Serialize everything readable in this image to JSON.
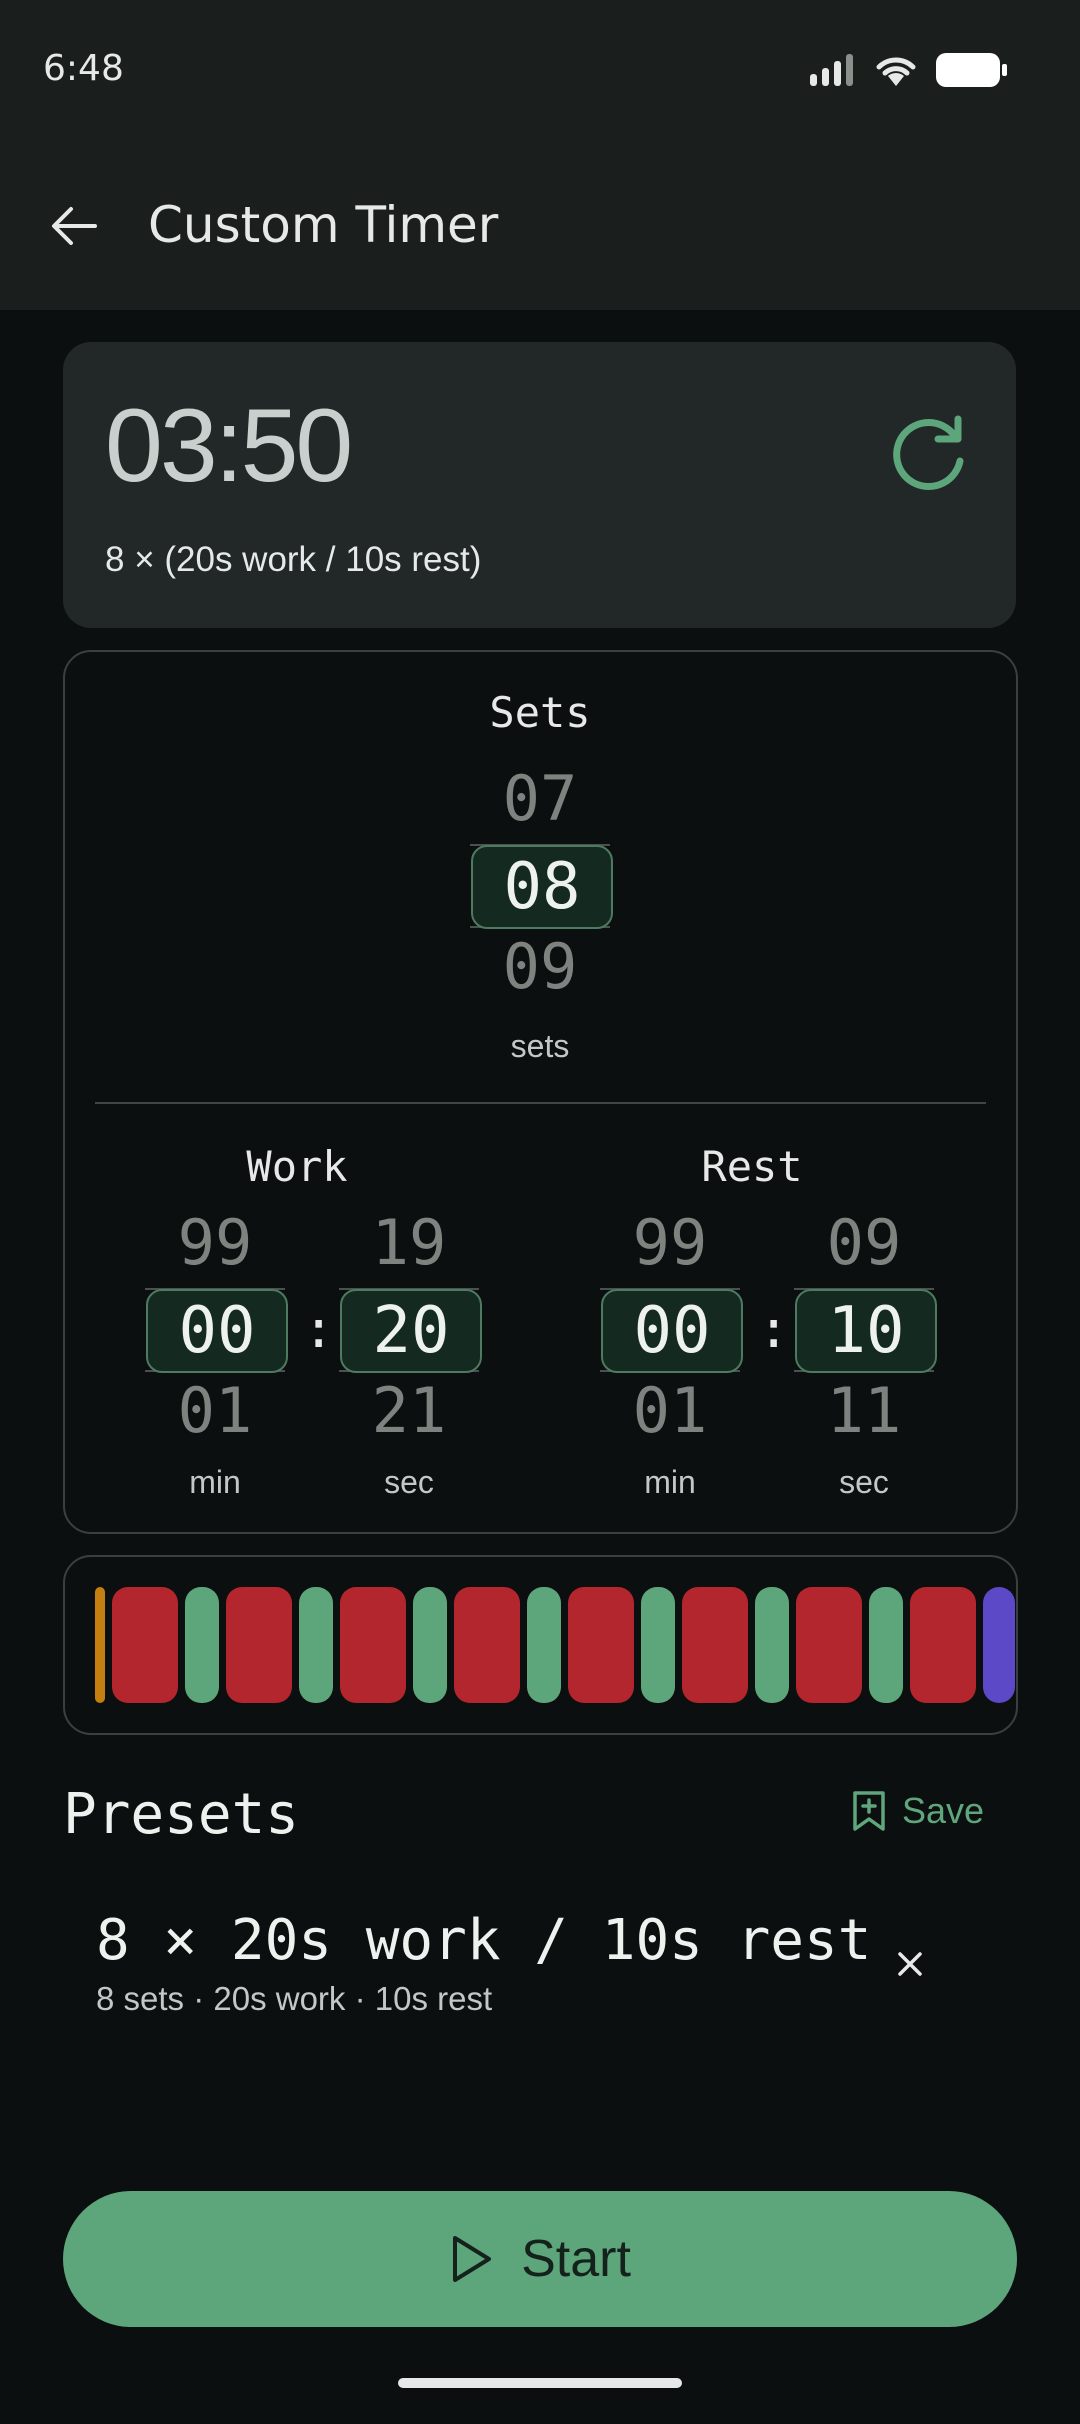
{
  "status": {
    "time": "6:48"
  },
  "header": {
    "title": "Custom Timer"
  },
  "summary": {
    "total": "03:50",
    "formula": "8 × (20s work / 10s rest)"
  },
  "sets": {
    "label": "Sets",
    "prev": "07",
    "value": "08",
    "next": "09",
    "unit": "sets"
  },
  "work": {
    "label": "Work",
    "min": {
      "prev": "99",
      "value": "00",
      "next": "01",
      "unit": "min"
    },
    "sec": {
      "prev": "19",
      "value": "20",
      "next": "21",
      "unit": "sec"
    }
  },
  "rest": {
    "label": "Rest",
    "min": {
      "prev": "99",
      "value": "00",
      "next": "01",
      "unit": "min"
    },
    "sec": {
      "prev": "09",
      "value": "10",
      "next": "11",
      "unit": "sec"
    }
  },
  "separator": ":",
  "timeline": {
    "colors": {
      "prep": "#c47f10",
      "work": "#b3262d",
      "rest": "#5da67c",
      "finish": "#5b49c8"
    },
    "segments": [
      "prep",
      "work",
      "rest",
      "work",
      "rest",
      "work",
      "rest",
      "work",
      "rest",
      "work",
      "rest",
      "work",
      "rest",
      "work",
      "rest",
      "work",
      "finish"
    ]
  },
  "presets": {
    "title": "Presets",
    "save_label": "Save",
    "items": [
      {
        "name": "8 × 20s work / 10s rest",
        "detail": "8 sets · 20s work · 10s rest"
      }
    ]
  },
  "start": {
    "label": "Start"
  },
  "colors": {
    "accent": "#5da67c",
    "background": "#0c0f0f",
    "card": "#222827"
  }
}
